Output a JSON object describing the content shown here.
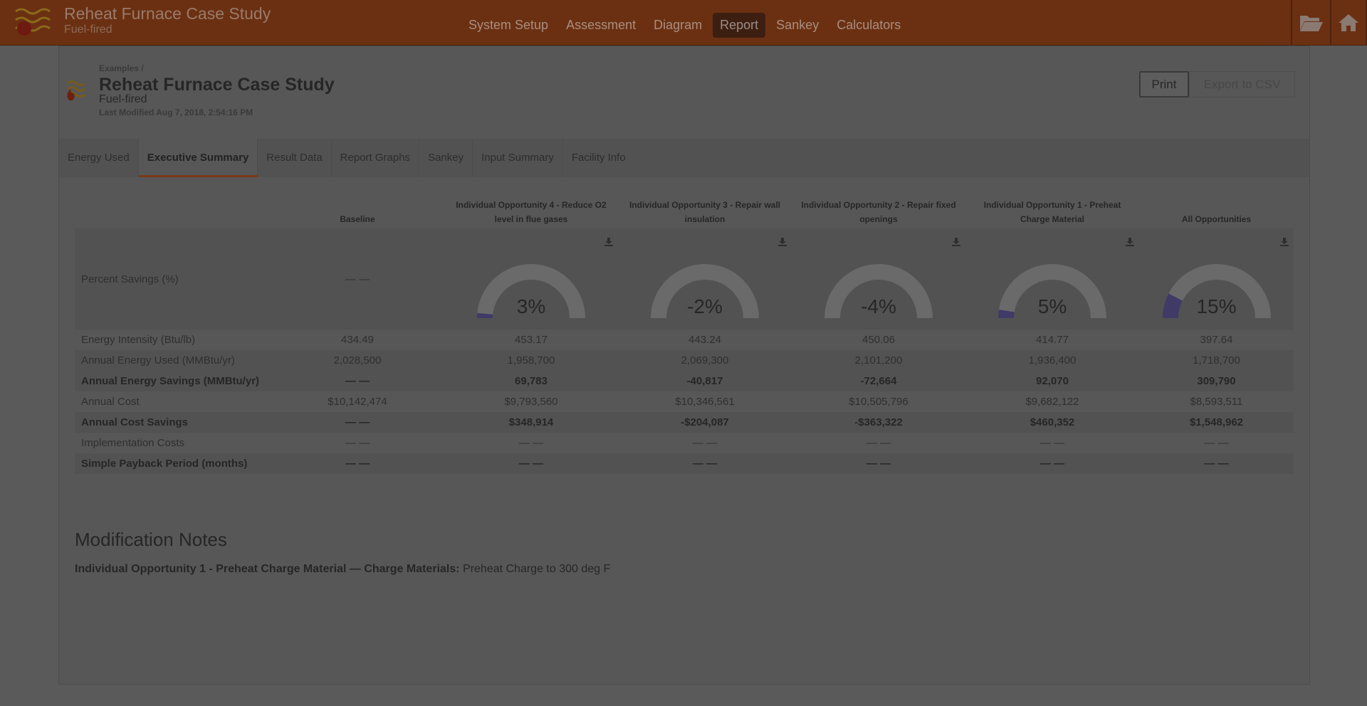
{
  "app": {
    "title": "Reheat Furnace Case Study",
    "subtitle": "Fuel-fired"
  },
  "nav": [
    "System Setup",
    "Assessment",
    "Diagram",
    "Report",
    "Sankey",
    "Calculators"
  ],
  "nav_active": "Report",
  "top_icons": [
    "folder-open-icon",
    "home-icon"
  ],
  "header": {
    "breadcrumb": "Examples /",
    "title": "Reheat Furnace Case Study",
    "subtitle": "Fuel-fired",
    "last_modified": "Last Modified Aug 7, 2018, 2:54:16 PM",
    "print_label": "Print",
    "export_label": "Export to CSV"
  },
  "tabs": [
    "Energy Used",
    "Executive Summary",
    "Result Data",
    "Report Graphs",
    "Sankey",
    "Input Summary",
    "Facility Info"
  ],
  "tab_active": "Executive Summary",
  "table": {
    "columns": [
      "Baseline",
      "Individual Opportunity 4 - Reduce O2 level in flue gases",
      "Individual Opportunity 3 - Repair wall insulation",
      "Individual Opportunity 2 - Repair fixed openings",
      "Individual Opportunity 1 - Preheat Charge Material",
      "All Opportunities"
    ],
    "percent_savings": {
      "label": "Percent Savings (%)",
      "baseline": "— —",
      "values": [
        "3%",
        "-2%",
        "-4%",
        "5%",
        "15%"
      ],
      "fractions": [
        3,
        -2,
        -4,
        5,
        15
      ]
    },
    "rows": [
      {
        "label": "Energy Intensity (Btu/lb)",
        "bold": false,
        "cells": [
          "434.49",
          "453.17",
          "443.24",
          "450.06",
          "414.77",
          "397.64"
        ]
      },
      {
        "label": "Annual Energy Used (MMBtu/yr)",
        "bold": false,
        "cells": [
          "2,028,500",
          "1,958,700",
          "2,069,300",
          "2,101,200",
          "1,936,400",
          "1,718,700"
        ]
      },
      {
        "label": "Annual Energy Savings (MMBtu/yr)",
        "bold": true,
        "cells": [
          "— —",
          "69,783",
          "-40,817",
          "-72,664",
          "92,070",
          "309,790"
        ]
      },
      {
        "label": "Annual Cost",
        "bold": false,
        "cells": [
          "$10,142,474",
          "$9,793,560",
          "$10,346,561",
          "$10,505,796",
          "$9,682,122",
          "$8,593,511"
        ]
      },
      {
        "label": "Annual Cost Savings",
        "bold": true,
        "cells": [
          "— —",
          "$348,914",
          "-$204,087",
          "-$363,322",
          "$460,352",
          "$1,548,962"
        ]
      },
      {
        "label": "Implementation Costs",
        "bold": false,
        "cells": [
          "— —",
          "— —",
          "— —",
          "— —",
          "— —",
          "— —"
        ]
      },
      {
        "label": "Simple Payback Period (months)",
        "bold": true,
        "cells": [
          "— —",
          "— —",
          "— —",
          "— —",
          "— —",
          "— —"
        ]
      }
    ]
  },
  "notes": {
    "title": "Modification Notes",
    "item_bold": "Individual Opportunity 1 - Preheat Charge Material — Charge Materials:",
    "item_text": "Preheat Charge to 300 deg F"
  },
  "colors": {
    "topbar": "#6b3012",
    "gauge_fill": "#3f3a66",
    "gauge_track": "#6a6a6a"
  }
}
